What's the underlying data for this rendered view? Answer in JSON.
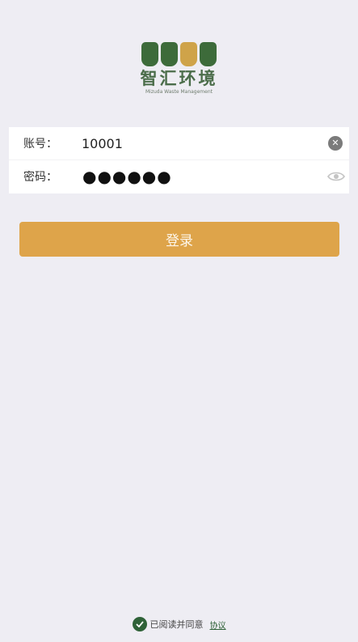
{
  "logo": {
    "name_cn": "智汇环境",
    "name_en": "Mizuda Waste Management"
  },
  "form": {
    "account_label": "账号：",
    "account_value": "10001",
    "password_label": "密码：",
    "password_mask": "●●●●●●"
  },
  "login": {
    "label": "登录"
  },
  "agreement": {
    "text": "已阅读并同意",
    "link": "协议"
  },
  "colors": {
    "background": "#eeedf3",
    "accent": "#dea44a",
    "brand_green": "#3d6b3a",
    "brand_gold": "#cfa349"
  },
  "icons": {
    "clear": "clear-icon",
    "eye": "eye-icon",
    "check": "check-circle-icon"
  }
}
